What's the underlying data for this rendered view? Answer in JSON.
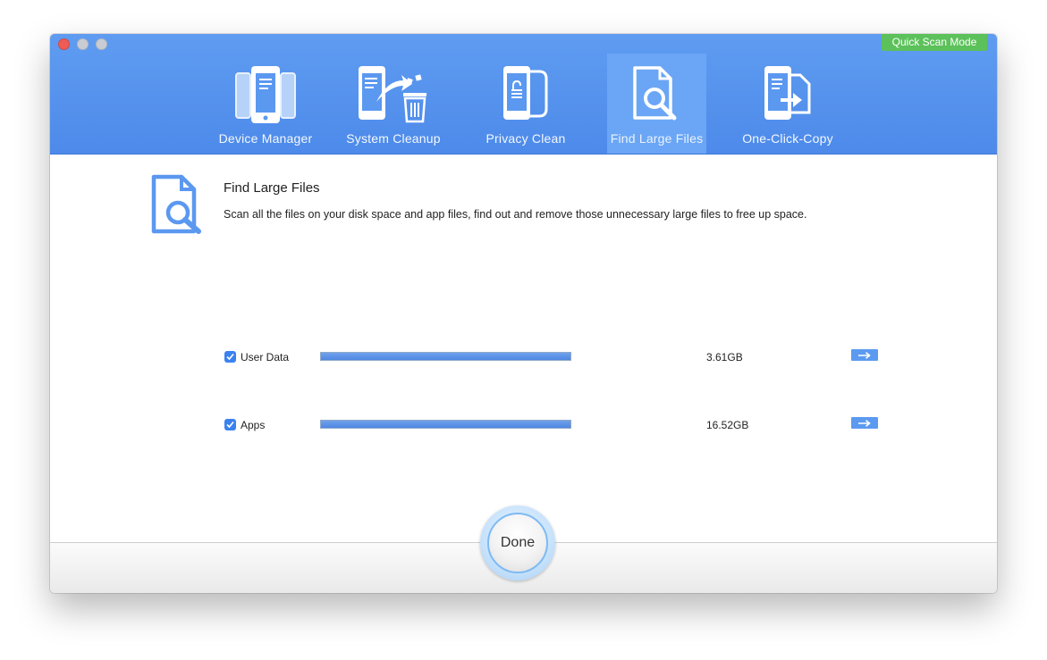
{
  "header": {
    "quick_scan_label": "Quick Scan Mode",
    "tabs": [
      {
        "label": "Device Manager",
        "icon": "phones-icon",
        "active": false
      },
      {
        "label": "System Cleanup",
        "icon": "cleanup-icon",
        "active": false
      },
      {
        "label": "Privacy Clean",
        "icon": "privacy-lock-icon",
        "active": false
      },
      {
        "label": "Find Large Files",
        "icon": "find-files-icon",
        "active": true
      },
      {
        "label": "One-Click-Copy",
        "icon": "copy-icon",
        "active": false
      }
    ]
  },
  "main": {
    "title": "Find Large Files",
    "description": "Scan all the files on your disk space and app files, find out and remove those unnecessary large files to free up space.",
    "rows": [
      {
        "label": "User Data",
        "size": "3.61GB",
        "checked": true,
        "fill_percent": 100
      },
      {
        "label": "Apps",
        "size": "16.52GB",
        "checked": true,
        "fill_percent": 100
      }
    ]
  },
  "footer": {
    "done_label": "Done"
  },
  "colors": {
    "header_blue": "#5b98f0",
    "active_tab": "#6aa6f5",
    "quick_scan_green": "#5cc15a",
    "accent_blue": "#3b82f0"
  }
}
